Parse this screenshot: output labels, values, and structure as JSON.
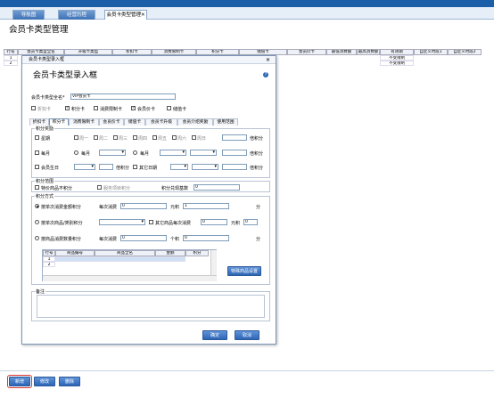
{
  "tabs": [
    {
      "label": "导航图"
    },
    {
      "label": "经营历程"
    },
    {
      "label": "会员卡类型管理"
    }
  ],
  "tab_close": "✕",
  "page_title": "会员卡类型管理",
  "grid": {
    "headers": [
      "行号",
      "会员卡类型全名",
      "升级卡类型",
      "折扣卡",
      "消费限制卡",
      "积分卡",
      "储值卡",
      "会员价卡",
      "最低消费额",
      "最高消费额",
      "有效期",
      "自定义时段1",
      "自定义时段2"
    ],
    "rows": [
      {
        "no": "1",
        "validity": "不受限制"
      },
      {
        "no": "2",
        "validity": "不受限制"
      }
    ]
  },
  "dialog": {
    "window_title": "会员卡类型录入框",
    "close": "✕",
    "title": "会员卡类型录入框",
    "help": "?",
    "name_label": "会员卡类型全名*",
    "name_value": "VIP会员卡",
    "card_types": [
      {
        "label": "折扣卡",
        "checked": false
      },
      {
        "label": "积分卡",
        "checked": true
      },
      {
        "label": "消费限制卡",
        "checked": false
      },
      {
        "label": "会员价卡",
        "checked": true
      },
      {
        "label": "储值卡",
        "checked": false
      }
    ],
    "inner_tabs": [
      "折扣卡",
      "积分卡",
      "消费限制卡",
      "会员价卡",
      "储值卡",
      "会员卡升级",
      "会员介绍奖励",
      "使用范围"
    ],
    "points_reward": {
      "group_title": "积分奖励",
      "weekly_label": "星期",
      "weekdays": [
        "周一",
        "周二",
        "周三",
        "周四",
        "周五",
        "周六",
        "周日"
      ],
      "times_points": "倍积分",
      "monthly_label": "每月",
      "each_month_a": "每月",
      "each_month_b": "每月",
      "birthday_label": "会员生日",
      "double_points": "倍积分",
      "other_date": "其它日期"
    },
    "points_range": {
      "group_title": "积分范围",
      "special_label": "特价商品不积分",
      "service_label": "服务项目积分",
      "base_label": "积分兑现基数",
      "base_value": "0"
    },
    "points_method": {
      "group_title": "积分方式",
      "opt1_label": "按单次消费金额积分",
      "every_label": "每次消费",
      "every_value": "0",
      "yuan_points": "元积",
      "points_value": "1",
      "fen": "分",
      "opt2_label": "按单次商品/类别积分",
      "other_goods": "其它商品每次消费",
      "other_value": "0",
      "yuan_points2": "元积",
      "points_value2": "0",
      "opt3_label": "按商品消费数量积分",
      "every_label3": "每次消费",
      "every_value3": "0",
      "per_points": "个积",
      "points_value3": "0",
      "fen3": "分"
    },
    "goods_table": {
      "headers": [
        "行号",
        "商品编号",
        "商品全名",
        "金额",
        "积分"
      ],
      "rows": [
        "1",
        "2"
      ]
    },
    "special_btn": "特殊商品设置",
    "remark_label": "备注",
    "ok_btn": "确定",
    "cancel_btn": "取消"
  },
  "bottom_buttons": [
    "新增",
    "修改",
    "删除"
  ],
  "colors": {
    "accent": "#2d66b6",
    "highlight": "#d9362e"
  }
}
